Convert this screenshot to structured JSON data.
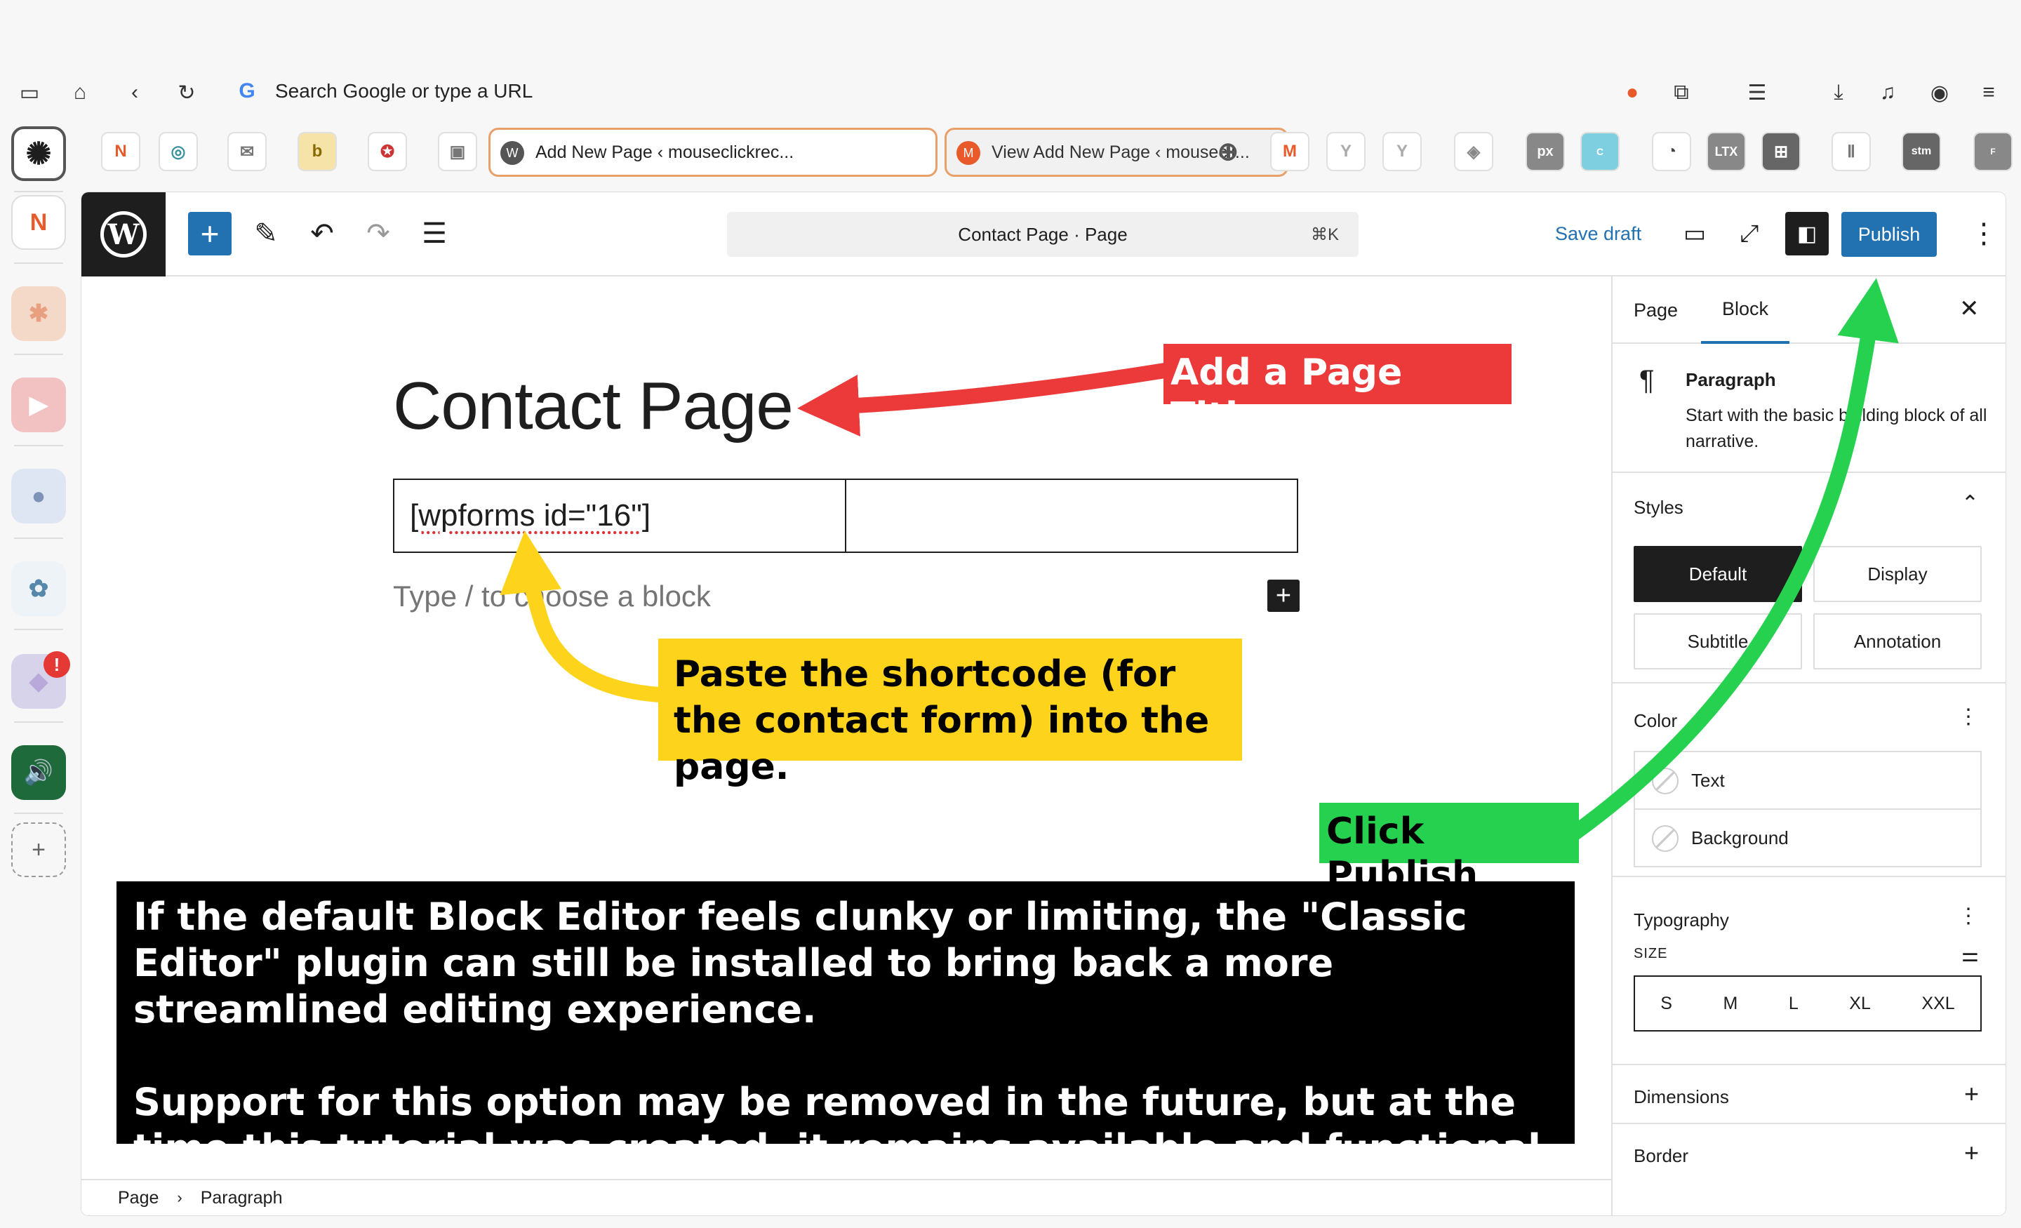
{
  "browser": {
    "address_placeholder": "Search Google or type a URL",
    "tabs": [
      {
        "label": "Add New Page ‹ mouseclickrec..."
      },
      {
        "label": "View Add New Page ‹ mousecli..."
      }
    ],
    "extensions": [
      "grid-icon",
      "download-icon",
      "profile-icon",
      "menu-icon"
    ]
  },
  "editor": {
    "command_bar": {
      "label": "Contact Page · Page",
      "shortcut": "⌘K"
    },
    "save_draft": "Save draft",
    "publish": "Publish",
    "page_title": "Contact Page",
    "shortcode": "[wpforms id=\"16\"]",
    "block_placeholder": "Type / to choose a block",
    "breadcrumb": {
      "root": "Page",
      "current": "Paragraph"
    }
  },
  "settings": {
    "tabs": [
      "Page",
      "Block"
    ],
    "active_tab": "Block",
    "block": {
      "name": "Paragraph",
      "description": "Start with the basic building block of all narrative."
    },
    "styles": {
      "title": "Styles",
      "options": [
        "Default",
        "Display",
        "Subtitle",
        "Annotation"
      ],
      "active": "Default"
    },
    "color": {
      "title": "Color",
      "items": [
        "Text",
        "Background"
      ]
    },
    "typography": {
      "title": "Typography",
      "size_label": "SIZE",
      "sizes": [
        "S",
        "M",
        "L",
        "XL",
        "XXL"
      ]
    },
    "dimensions": {
      "title": "Dimensions"
    },
    "border": {
      "title": "Border"
    }
  },
  "annotations": {
    "title_hint": "Add a Page Title",
    "shortcode_hint": "Paste the shortcode (for the contact form) into the page.",
    "publish_hint": "Click Publish",
    "note_line1": "If the default Block Editor feels clunky or limiting, the \"Classic Editor\" plugin can still be installed to bring back a more streamlined editing experience.",
    "note_line2": "Support for this option may be removed in the future, but at the time this tutorial was created, it remains available and functional."
  },
  "colors": {
    "wp_blue": "#2271b1",
    "arrow_red": "#ec3a3a",
    "arrow_yellow": "#fdd31b",
    "arrow_green": "#27d150"
  }
}
